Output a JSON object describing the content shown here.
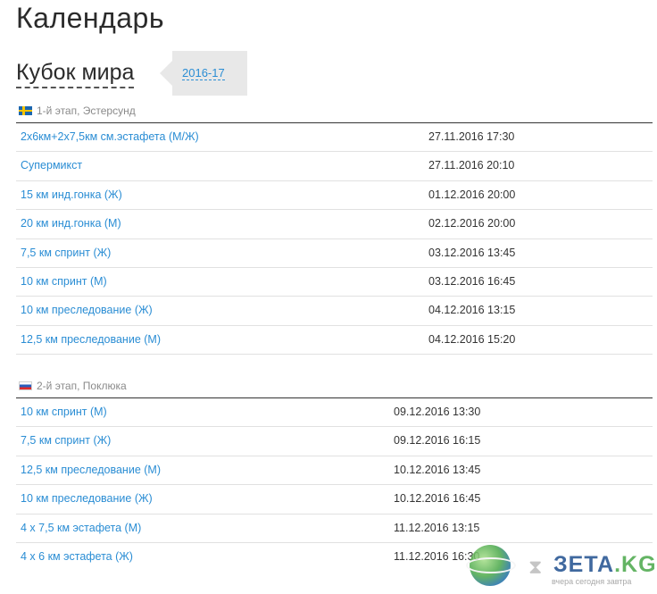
{
  "page": {
    "title": "Календарь",
    "subtitle": "Кубок мира",
    "season_link": "2016-17"
  },
  "stages": [
    {
      "header": "1-й этап, Эстерсунд",
      "flag": "sweden-flag-icon",
      "events": [
        {
          "name": "2х6км+2х7,5км см.эстафета (М/Ж)",
          "time": "27.11.2016 17:30"
        },
        {
          "name": "Супермикст",
          "time": "27.11.2016 20:10"
        },
        {
          "name": "15 км инд.гонка (Ж)",
          "time": "01.12.2016 20:00"
        },
        {
          "name": "20 км инд.гонка (М)",
          "time": "02.12.2016 20:00"
        },
        {
          "name": "7,5 км спринт (Ж)",
          "time": "03.12.2016 13:45"
        },
        {
          "name": "10 км спринт (М)",
          "time": "03.12.2016 16:45"
        },
        {
          "name": "10 км преследование (Ж)",
          "time": "04.12.2016 13:15"
        },
        {
          "name": "12,5 км преследование (М)",
          "time": "04.12.2016 15:20"
        }
      ]
    },
    {
      "header": "2-й этап, Поклюка",
      "flag": "slovenia-flag-icon",
      "events": [
        {
          "name": "10 км спринт (М)",
          "time": "09.12.2016 13:30"
        },
        {
          "name": "7,5 км спринт (Ж)",
          "time": "09.12.2016 16:15"
        },
        {
          "name": "12,5 км преследование (М)",
          "time": "10.12.2016 13:45"
        },
        {
          "name": "10 км преследование (Ж)",
          "time": "10.12.2016 16:45"
        },
        {
          "name": "4 х 7,5 км эстафета (М)",
          "time": "11.12.2016 13:15"
        },
        {
          "name": "4 х 6 км эстафета (Ж)",
          "time": "11.12.2016 16:30"
        }
      ]
    }
  ],
  "watermark": {
    "logo_main": "ЗЕТА",
    "logo_accent": ".KG",
    "tagline": "вчера сегодня завтра"
  },
  "colors": {
    "link": "#2a8dd4",
    "text": "#333333",
    "muted": "#8a8a8a",
    "season_bg": "#e8e8e8"
  }
}
